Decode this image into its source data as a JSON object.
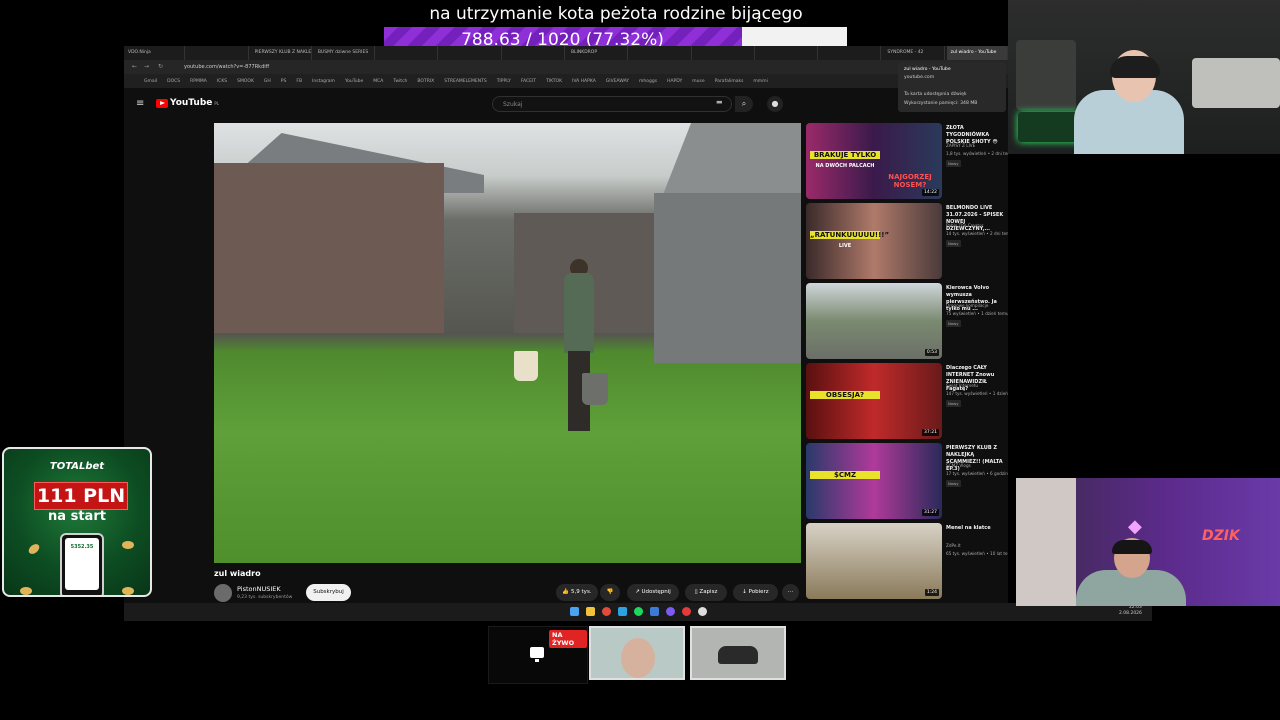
{
  "goal": {
    "title": "na utrzymanie kota peżota rodzine bijącego",
    "progress_text": "788.63 / 1020 (77.32%)",
    "progress_fraction": 0.7732,
    "fill_color": "#8e2fd8"
  },
  "browser": {
    "tabs": [
      "VDO.Ninja",
      "",
      "PIERWSZY KLUB Z NAKLEJKĄ",
      "BUSMY dziwne SERIES",
      "",
      "",
      "",
      "BLINKDROP",
      "",
      "",
      "",
      "",
      "SYNDROME - 42",
      "zul wiadro - YouTube"
    ],
    "url": "youtube.com/watch?v=-877Rkdiff",
    "bookmarks": [
      "Gmail",
      "DOCS",
      "RPMMA",
      "ICKS",
      "SMOOK",
      "GH",
      "PS",
      "FB",
      "Instagram",
      "YouTube",
      "MCA",
      "Twitch",
      "BOTRIX",
      "STREAMELEMENTS",
      "TIPPLY",
      "FACEIT",
      "TIKTOK",
      "IVA HAPKA",
      "GIVEAWAY",
      "mhoggs",
      "HAPDY",
      "muse",
      "Parafalimaks",
      "mmmi"
    ],
    "tab_tooltip": {
      "title": "zul wiadro - YouTube",
      "domain": "youtube.com",
      "line1": "Ta karta udostępnia dźwięk",
      "line2": "Wykorzystanie pamięci: 348 MB"
    }
  },
  "youtube": {
    "logo": "YouTube",
    "region": "PL",
    "search_placeholder": "Szukaj",
    "video_title": "zul wiadro",
    "channel_name": "PistonNUSIEK",
    "channel_subs": "9,23 tys. subskrybentów",
    "subscribe_label": "Subskrybuj",
    "likes_label": "5,9 tys.",
    "share_label": "Udostępnij",
    "save_label": "Zapisz",
    "download_label": "Pobierz",
    "recommendations": [
      {
        "title": "ZŁOTA TYGODNIÓWKA POLSKIE SHOTY 😳",
        "channel": "ZAPISY Z LIVE",
        "meta": "1,8 tys. wyświetleń • 2 dni temu",
        "badge": "Nowy",
        "duration": "14:22",
        "thumb_text_1": "BRAKUJE TYLKO",
        "thumb_text_2": "NA DWÓCH PALCACH",
        "thumb_text_3": "NAJGORZEJ NOSEM?"
      },
      {
        "title": "BELMONDO LIVE 31.07.2026 - SPISEK NOWEJ DZIEWCZYNY,...",
        "channel": "Pablo The Creator",
        "meta": "14 tys. wyświetleń • 2 dni temu",
        "badge": "Nowy",
        "duration": "",
        "thumb_text_1": "„RATUNKUUUUU!!!”",
        "thumb_text_2": "LIVE",
        "thumb_text_3": ""
      },
      {
        "title": "Kierowca Volvo wymusza pierwszeństwo. Ja tylko mu ...",
        "channel": "Drogowe kompilacje",
        "meta": "75 wyświetleń • 1 dzień temu",
        "badge": "Nowy",
        "duration": "0:53",
        "thumb_text_1": "",
        "thumb_text_2": "",
        "thumb_text_3": ""
      },
      {
        "title": "Dlaczego CAŁY INTERNET Znowu ZNIENAWIDZIŁ Fagatę?",
        "channel": "Świat Internetu",
        "meta": "147 tys. wyświetleń • 1 dzień temu",
        "badge": "Nowy",
        "duration": "37:21",
        "thumb_text_1": "OBSESJA?",
        "thumb_text_2": "",
        "thumb_text_3": ""
      },
      {
        "title": "PIERWSZY KLUB Z NAKLEJKĄ SCAMMIEZ!! (MALTA EP.3)",
        "channel": "SCMZ Vlogs",
        "meta": "17 tys. wyświetleń • 6 godzin temu",
        "badge": "Nowy",
        "duration": "31:27",
        "thumb_text_1": "$CMZ",
        "thumb_text_2": "",
        "thumb_text_3": ""
      },
      {
        "title": "Menel na klatce",
        "channel": "ZdPe.lt",
        "meta": "65 tys. wyświetleń • 10 lat temu",
        "badge": "",
        "duration": "1:24",
        "thumb_text_1": "",
        "thumb_text_2": "",
        "thumb_text_3": ""
      }
    ]
  },
  "taskbar": {
    "clock_time": "22:03",
    "clock_date": "2.08.2026"
  },
  "ad": {
    "brand": "TOTALbet",
    "amount": "111 PLN",
    "subtitle": "na start",
    "phone_value": "5352.35"
  },
  "cam_bottom": {
    "logo_text": "DZIK"
  },
  "stream_strip": {
    "live_badge": "NA ŻYWO"
  }
}
